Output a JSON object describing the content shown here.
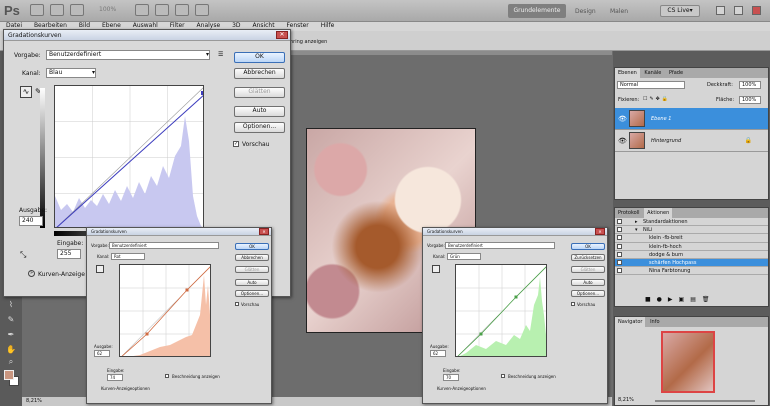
{
  "app": {
    "logo": "Ps",
    "zoom": "100%"
  },
  "workspaces": {
    "active": "Grundelemente",
    "items": [
      "Design",
      "Malen"
    ]
  },
  "cslive": "CS Live▾",
  "menu": [
    "Datei",
    "Bearbeiten",
    "Bild",
    "Ebene",
    "Auswahl",
    "Filter",
    "Analyse",
    "3D",
    "Ansicht",
    "Fenster",
    "Hilfe"
  ],
  "options": {
    "text": "hring anzeigen"
  },
  "status": {
    "zoom": "8,21%"
  },
  "main_dialog": {
    "title": "Gradationskurven",
    "preset_label": "Vorgabe:",
    "preset_value": "Benutzerdefiniert",
    "channel_label": "Kanal:",
    "channel_value": "Blau",
    "output_label": "Ausgabe:",
    "output_value": "240",
    "input_label": "Eingabe:",
    "input_value": "255",
    "curve_options": "Kurven-Anzeige",
    "buttons": {
      "ok": "OK",
      "cancel": "Abbrechen",
      "smooth": "Glätten",
      "auto": "Auto",
      "options": "Optionen..."
    },
    "preview": "Vorschau",
    "histogram_color": "#c8c8f0",
    "curve_color": "#3c3cbe"
  },
  "red_dialog": {
    "title": "Gradationskurven",
    "preset_label": "Vorgabe:",
    "preset_value": "Benutzerdefiniert",
    "channel_label": "Kanal:",
    "channel_value": "Rot",
    "output_label": "Ausgabe:",
    "output_value": "62",
    "input_label": "Eingabe:",
    "input_value": "74",
    "clip_label": "Beschneidung anzeigen",
    "curve_options": "Kurven-Anzeigeoptionen",
    "buttons": {
      "ok": "OK",
      "cancel": "Abbrechen",
      "smooth": "Glätten",
      "auto": "Auto",
      "options": "Optionen..."
    },
    "preview": "Vorschau",
    "histogram_color": "#f5c0a8",
    "curve_color": "#d06a40"
  },
  "green_dialog": {
    "title": "Gradationskurven",
    "preset_label": "Vorgabe:",
    "preset_value": "Benutzerdefiniert",
    "channel_label": "Kanal:",
    "channel_value": "Grün",
    "output_label": "Ausgabe:",
    "output_value": "62",
    "input_label": "Eingabe:",
    "input_value": "70",
    "clip_label": "Beschneidung anzeigen",
    "curve_options": "Kurven-Anzeigeoptionen",
    "buttons": {
      "ok": "OK",
      "cancel": "Zurücksetzen",
      "smooth": "Glätten",
      "auto": "Auto",
      "options": "Optionen..."
    },
    "preview": "Vorschau",
    "histogram_color": "#b8f0b0",
    "curve_color": "#4aa048"
  },
  "layers_panel": {
    "tabs": [
      "Ebenen",
      "Kanäle",
      "Pfade"
    ],
    "blend_mode": "Normal",
    "opacity_label": "Deckkraft:",
    "opacity_value": "100%",
    "lock_label": "Fixieren:",
    "fill_label": "Fläche:",
    "fill_value": "100%",
    "layers": [
      {
        "name": "Ebene 1",
        "selected": true
      },
      {
        "name": "Hintergrund",
        "selected": false
      }
    ]
  },
  "actions_panel": {
    "tabs": [
      "Protokoll",
      "Aktionen"
    ],
    "items": [
      {
        "name": "Standardaktionen",
        "selected": false
      },
      {
        "name": "NiLi",
        "selected": false
      },
      {
        "name": "klein -fb-breit",
        "selected": false
      },
      {
        "name": "klein-fb-hoch",
        "selected": false
      },
      {
        "name": "dodge & burn",
        "selected": false
      },
      {
        "name": "schärfen Hochpass",
        "selected": true
      },
      {
        "name": "Nina Farbtonung",
        "selected": false
      }
    ]
  },
  "navigator_panel": {
    "tabs": [
      "Navigator",
      "Info"
    ],
    "zoom": "8,21%"
  }
}
